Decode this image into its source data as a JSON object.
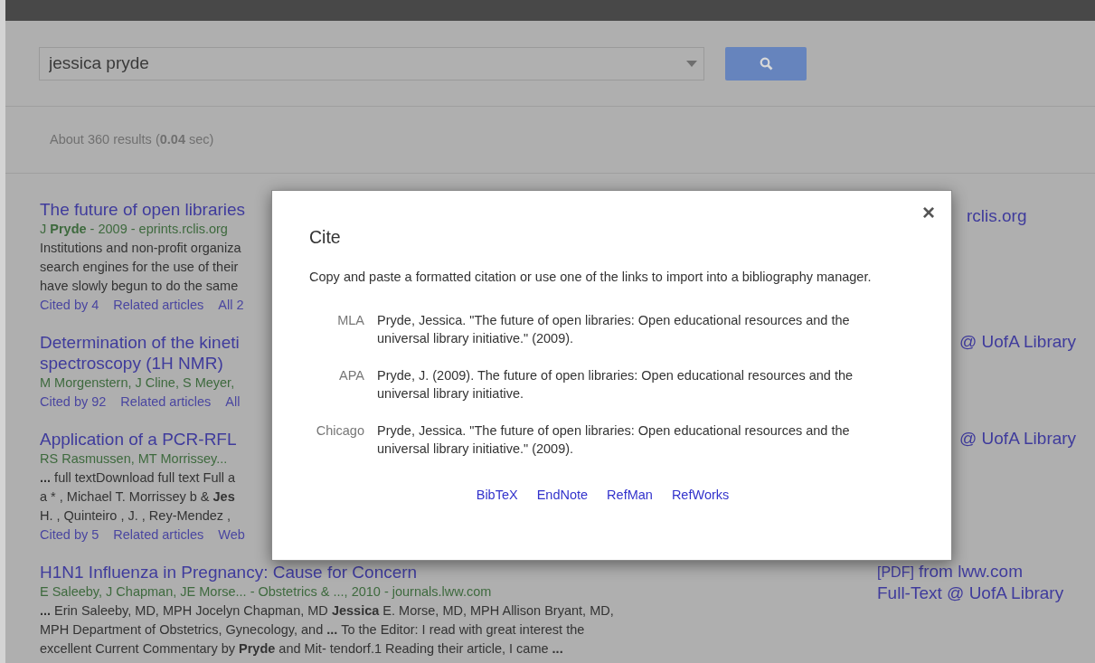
{
  "search": {
    "value": "jessica pryde"
  },
  "results_summary": "About 360 results (**0.04** sec)",
  "results": [
    {
      "title": [
        "The future of open libraries"
      ],
      "authors": "J **Pryde** - 2009 - eprints.rclis.org",
      "snippet": [
        "Institutions and non-profit organiza",
        "search engines for the use of their",
        "have slowly begun to do the same"
      ],
      "links": [
        "Cited by 4",
        "Related articles",
        "All 2"
      ],
      "side_links": [
        {
          "text": "rclis.org"
        }
      ]
    },
    {
      "title": [
        "Determination of the kineti",
        "spectroscopy (1H NMR)"
      ],
      "authors": "M Morgenstern, J Cline, S Meyer,",
      "links": [
        "Cited by 92",
        "Related articles",
        "All"
      ],
      "side_links": [
        {
          "text": "@ UofA Library"
        }
      ]
    },
    {
      "title": [
        "Application of a PCR-RFL"
      ],
      "authors": "RS Rasmussen, MT Morrissey...",
      "snippet": [
        "**...** full textDownload full text Full a",
        "a * , Michael T. Morrissey b & **Jes**",
        "H. , Quinteiro , J. , Rey-Mendez ,"
      ],
      "links": [
        "Cited by 5",
        "Related articles",
        "Web"
      ],
      "side_links": [
        {
          "text": "@ UofA Library"
        }
      ]
    },
    {
      "title": [
        "H1N1 Influenza in Pregnancy: Cause for Concern"
      ],
      "authors": "E Saleeby, J Chapman, JE Morse... - Obstetrics & ..., 2010 - journals.lww.com",
      "snippet": [
        "**...** Erin Saleeby, MD, MPH Jocelyn Chapman, MD **Jessica** E. Morse, MD, MPH Allison Bryant, MD,",
        "MPH Department of Obstetrics, Gynecology, and **...** To the Editor: I read with great interest the",
        "excellent Current Commentary by **Pryde** and Mit- tendorf.1 Reading their article, I came **...**"
      ],
      "side_links": [
        {
          "tag": "[PDF]",
          "text": "from lww.com"
        },
        {
          "text": "Full-Text @ UofA Library"
        }
      ]
    }
  ],
  "dialog": {
    "title": "Cite",
    "close": "×",
    "intro": "Copy and paste a formatted citation or use one of the links to import into a bibliography manager.",
    "citations": [
      {
        "style": "MLA",
        "text": "Pryde, Jessica. \"The future of open libraries: Open educational resources and the universal library initiative.\" (2009)."
      },
      {
        "style": "APA",
        "text": "Pryde, J. (2009). The future of open libraries: Open educational resources and the universal library initiative."
      },
      {
        "style": "Chicago",
        "text": "Pryde, Jessica. \"The future of open libraries: Open educational resources and the universal library initiative.\" (2009)."
      }
    ],
    "export_links": [
      "BibTeX",
      "EndNote",
      "RefMan",
      "RefWorks"
    ]
  }
}
